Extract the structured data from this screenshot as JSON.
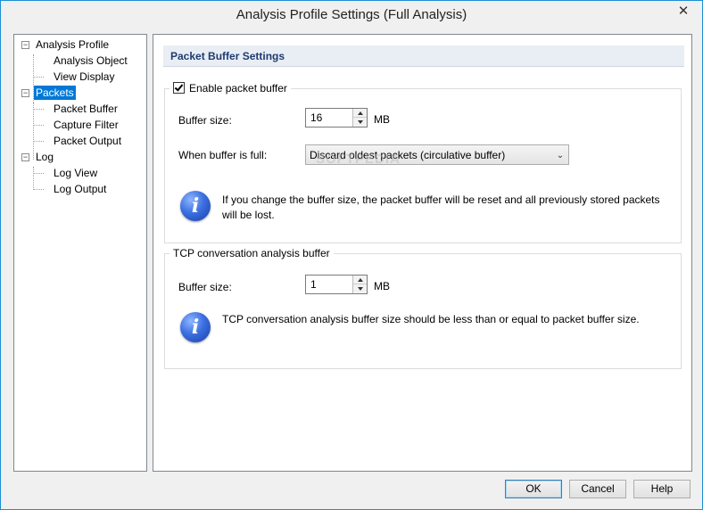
{
  "window": {
    "title": "Analysis Profile Settings (Full Analysis)",
    "close_glyph": "✕"
  },
  "tree": {
    "items": [
      {
        "label": "Analysis Profile",
        "expander": "−"
      },
      {
        "label": "Analysis Object"
      },
      {
        "label": "View Display"
      },
      {
        "label": "Packets",
        "expander": "−",
        "selected": true
      },
      {
        "label": "Packet Buffer"
      },
      {
        "label": "Capture Filter"
      },
      {
        "label": "Packet Output"
      },
      {
        "label": "Log",
        "expander": "−"
      },
      {
        "label": "Log View"
      },
      {
        "label": "Log Output"
      }
    ]
  },
  "content": {
    "section_title": "Packet Buffer Settings",
    "packet_buffer": {
      "enable_label": "Enable packet buffer",
      "enable_checked": true,
      "buffer_size_label": "Buffer size:",
      "buffer_size_value": "16",
      "buffer_size_unit": "MB",
      "when_full_label": "When buffer is full:",
      "when_full_value": "Discard oldest packets (circulative buffer)",
      "info_text": "If you change the buffer size, the packet buffer will be reset and all previously stored packets will be lost."
    },
    "tcp_buffer": {
      "legend": "TCP conversation analysis buffer",
      "buffer_size_label": "Buffer size:",
      "buffer_size_value": "1",
      "buffer_size_unit": "MB",
      "info_text": "TCP conversation analysis buffer size should be less than or equal to packet buffer size."
    },
    "watermark": "SOFTPEDIA"
  },
  "footer": {
    "ok_label": "OK",
    "cancel_label": "Cancel",
    "help_label": "Help"
  },
  "colors": {
    "selection": "#0078d7",
    "header_text": "#1e3a6e",
    "header_bg": "#e9eef5",
    "info_icon": "#3b6fe0"
  }
}
